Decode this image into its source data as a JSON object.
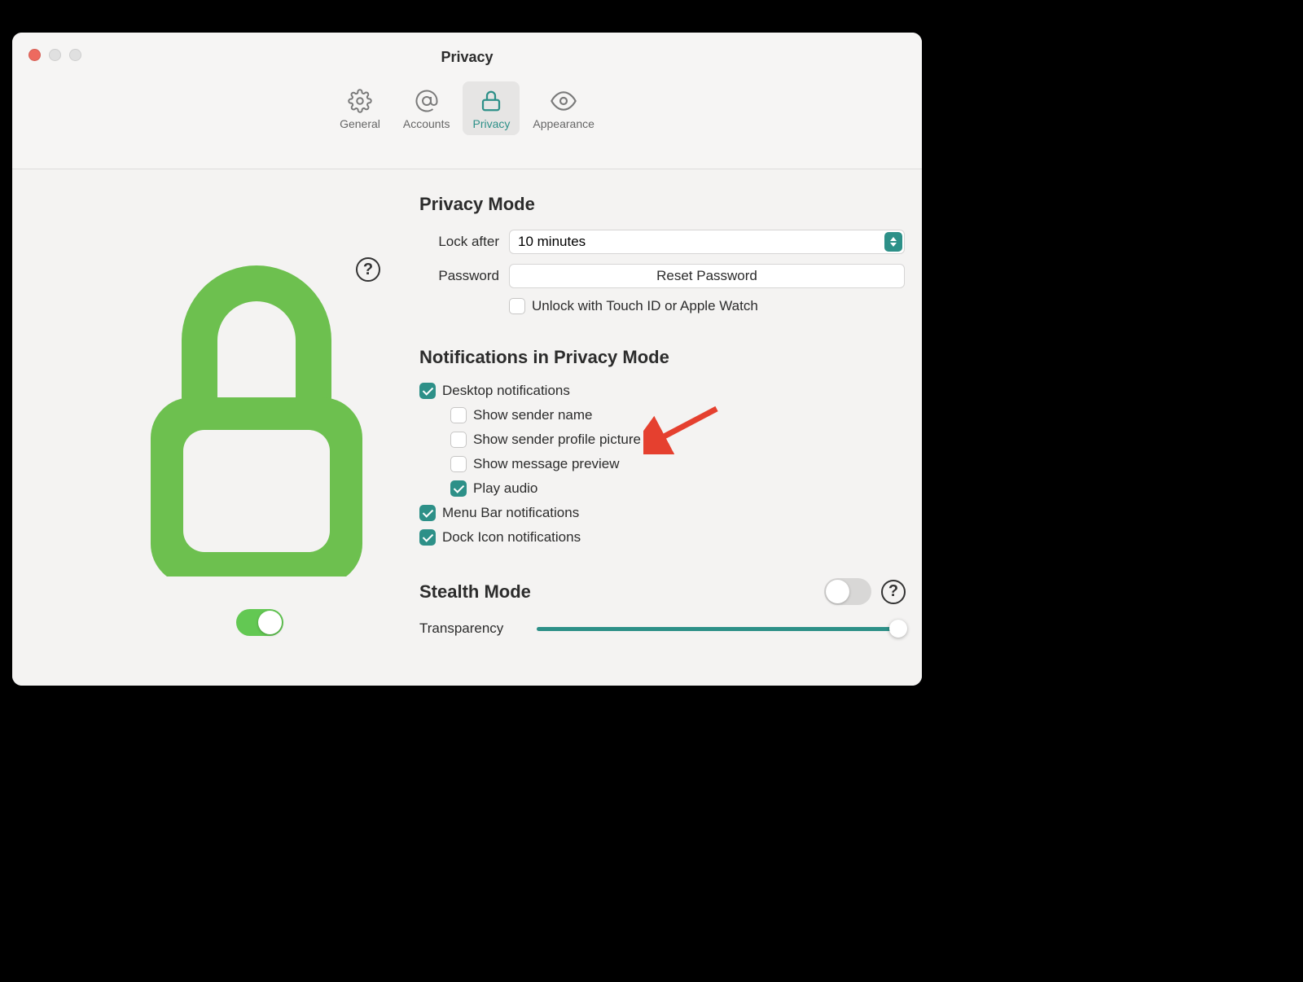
{
  "window": {
    "title": "Privacy"
  },
  "tabs": {
    "general": "General",
    "accounts": "Accounts",
    "privacy": "Privacy",
    "appearance": "Appearance"
  },
  "privacy_mode": {
    "title": "Privacy Mode",
    "lock_after_label": "Lock after",
    "lock_after_value": "10 minutes",
    "password_label": "Password",
    "reset_button": "Reset Password",
    "unlock_touchid_label": "Unlock with Touch ID or Apple Watch",
    "unlock_touchid_checked": false,
    "toggle_on": true
  },
  "notifications": {
    "title": "Notifications in Privacy Mode",
    "desktop": {
      "label": "Desktop notifications",
      "checked": true
    },
    "show_sender_name": {
      "label": "Show sender name",
      "checked": false
    },
    "show_sender_picture": {
      "label": "Show sender profile picture",
      "checked": false
    },
    "show_message_preview": {
      "label": "Show message preview",
      "checked": false
    },
    "play_audio": {
      "label": "Play audio",
      "checked": true
    },
    "menu_bar": {
      "label": "Menu Bar notifications",
      "checked": true
    },
    "dock_icon": {
      "label": "Dock Icon notifications",
      "checked": true
    }
  },
  "stealth": {
    "title": "Stealth Mode",
    "toggle_on": false,
    "transparency_label": "Transparency",
    "transparency_value": 100
  },
  "colors": {
    "accent": "#2d9088",
    "lock_green": "#6dc04f"
  }
}
